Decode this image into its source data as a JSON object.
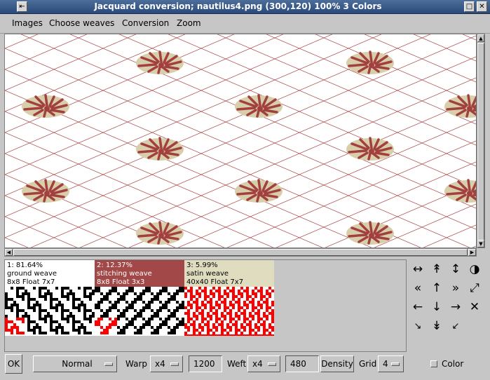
{
  "window": {
    "title": "Jacquard conversion; nautilus4.png (300,120) 100% 3 Colors",
    "menu_icon": "window-menu-icon",
    "minimize_icon": "minimize-icon",
    "close_icon": "close-icon"
  },
  "menubar": {
    "items": [
      "Images",
      "Choose weaves",
      "Conversion",
      "Zoom"
    ]
  },
  "weaves": [
    {
      "line1": "1: 81.64%",
      "line2": "ground weave",
      "line3": "8x8 Float 7x7",
      "color": "#ffffff",
      "text_color": "#000000"
    },
    {
      "line1": "2: 12.37%",
      "line2": "stitching weave",
      "line3": "8x8 Float 3x3",
      "color": "#a24848",
      "text_color": "#ffffff"
    },
    {
      "line1": "3: 5.99%",
      "line2": "satin weave",
      "line3": "40x40 Float 7x7",
      "color": "#e0dcc0",
      "text_color": "#000000"
    }
  ],
  "nav_icons": [
    "expand-horizontal-icon",
    "double-up-icon",
    "expand-vertical-icon",
    "half-fill-icon",
    "double-left-icon",
    "up-icon",
    "double-right-icon",
    "shrink-diagonal-icon",
    "left-icon",
    "down-icon",
    "right-icon",
    "cross-icon",
    "flip-diagonal-left-icon",
    "double-down-icon",
    "flip-diagonal-right-icon"
  ],
  "bottom": {
    "ok_label": "OK",
    "mode_value": "Normal",
    "warp_label": "Warp",
    "warp_mult": "x4",
    "warp_value": "1200",
    "weft_label": "Weft",
    "weft_mult": "x4",
    "weft_value": "480",
    "density_label": "Density",
    "grid_label": "Grid",
    "grid_value": "4",
    "color_label": "Color"
  },
  "colors": {
    "grid_line": "#a84040",
    "shell_fill": "#d8ceaa",
    "shell_stripe": "#a24040",
    "weave_red": "#ff0000"
  }
}
